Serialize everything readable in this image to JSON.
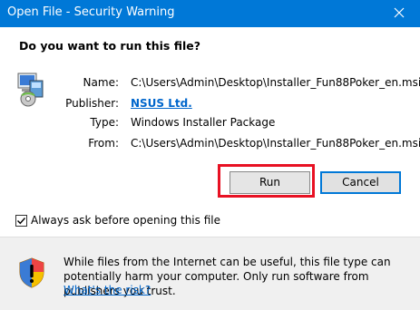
{
  "window": {
    "title": "Open File - Security Warning",
    "close_icon": "close-icon"
  },
  "dialog": {
    "question": "Do you want to run this file?",
    "fields": {
      "name_label": "Name:",
      "name_value": "C:\\Users\\Admin\\Desktop\\Installer_Fun88Poker_en.msi",
      "publisher_label": "Publisher:",
      "publisher_value": "NSUS Ltd.",
      "type_label": "Type:",
      "type_value": "Windows Installer Package",
      "from_label": "From:",
      "from_value": "C:\\Users\\Admin\\Desktop\\Installer_Fun88Poker_en.msi"
    },
    "file_icon": "msi-installer-icon"
  },
  "buttons": {
    "run": "Run",
    "cancel": "Cancel"
  },
  "checkbox": {
    "label": "Always ask before opening this file",
    "checked": true
  },
  "footer": {
    "shield_icon": "security-shield-icon",
    "warning_text": "While files from the Internet can be useful, this file type can potentially harm your computer. Only run software from publishers you trust.",
    "risk_link": "What's the risk?"
  },
  "colors": {
    "titlebar": "#0078d7",
    "highlight": "#e81123",
    "link": "#0066cc"
  }
}
